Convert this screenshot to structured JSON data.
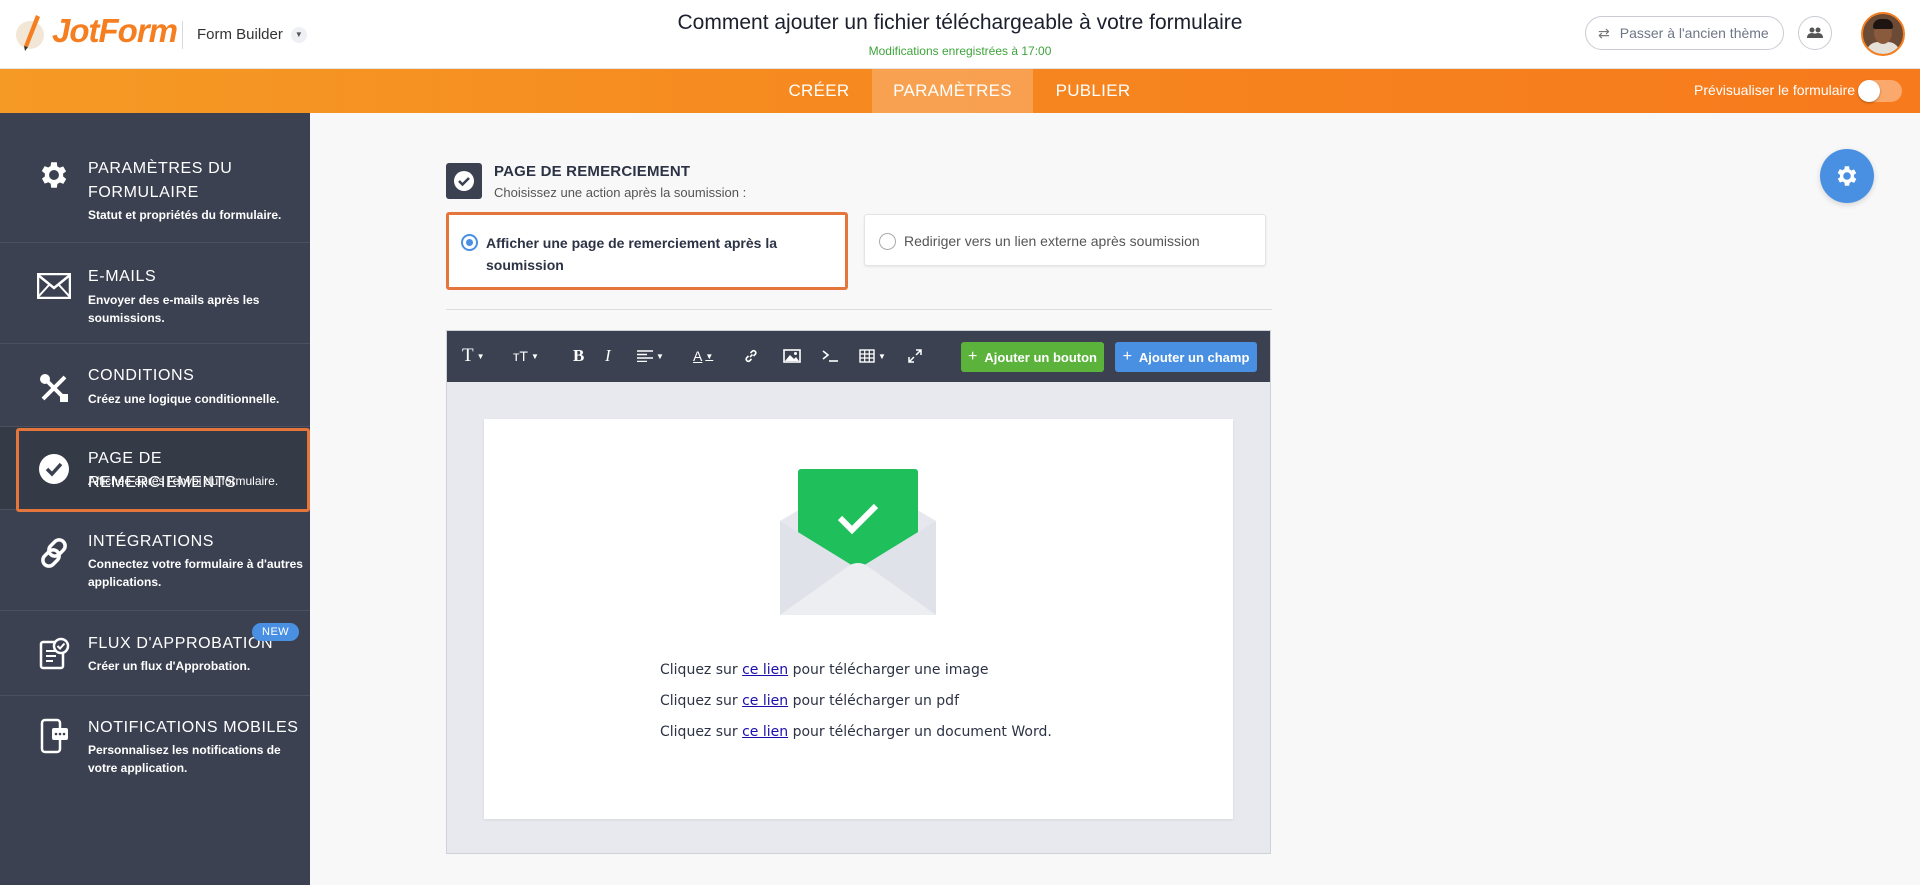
{
  "header": {
    "brand": "JotForm",
    "builder_label": "Form Builder",
    "form_title": "Comment ajouter un fichier téléchargeable à votre formulaire",
    "save_status": "Modifications enregistrées à 17:00",
    "old_theme_label": "Passer à l'ancien thème"
  },
  "nav": {
    "tabs": [
      {
        "label": "CRÉER",
        "active": false
      },
      {
        "label": "PARAMÈTRES",
        "active": true
      },
      {
        "label": "PUBLIER",
        "active": false
      }
    ],
    "preview_label": "Prévisualiser le formulaire",
    "preview_on": false
  },
  "sidebar": {
    "items": [
      {
        "icon": "gear-icon",
        "title_lines": [
          "PARAMÈTRES DU",
          "FORMULAIRE"
        ],
        "desc_lines": [
          "Statut et propriétés du formulaire."
        ]
      },
      {
        "icon": "envelope-icon",
        "title_lines": [
          "E-MAILS"
        ],
        "desc_lines": [
          "Envoyer des e-mails après les",
          "soumissions."
        ]
      },
      {
        "icon": "conditions-icon",
        "title_lines": [
          "CONDITIONS"
        ],
        "desc_lines": [
          "Créez une logique conditionnelle."
        ]
      },
      {
        "icon": "check-circle-icon",
        "title_lines": [
          "PAGE DE REMERCIEMENTS"
        ],
        "desc_lines": [
          "Affichée après l'envoi du formulaire."
        ],
        "selected": true
      },
      {
        "icon": "link-icon",
        "title_lines": [
          "INTÉGRATIONS"
        ],
        "desc_lines": [
          "Connectez votre formulaire à d'autres",
          "applications."
        ]
      },
      {
        "icon": "approval-icon",
        "title_lines": [
          "FLUX D'APPROBATION"
        ],
        "desc_lines": [
          "Créer un flux d'Approbation."
        ],
        "badge": "NEW"
      },
      {
        "icon": "mobile-notification-icon",
        "title_lines": [
          "NOTIFICATIONS MOBILES"
        ],
        "desc_lines": [
          "Personnalisez les notifications de",
          "votre application."
        ]
      }
    ]
  },
  "thankyou": {
    "section_title": "PAGE DE REMERCIEMENT",
    "section_subtitle": "Choisissez une action après la soumission :",
    "option_show_page": "Afficher une page de remerciement après la soumission",
    "option_redirect": "Rediriger vers un lien externe après soumission",
    "selected_option": "show_page"
  },
  "editor": {
    "add_button_label": "Ajouter un bouton",
    "add_field_label": "Ajouter un champ",
    "lines": [
      {
        "before": "Cliquez sur ",
        "link": "ce lien",
        "after": " pour télécharger une image"
      },
      {
        "before": "Cliquez sur ",
        "link": "ce lien",
        "after": " pour télécharger un pdf"
      },
      {
        "before": "Cliquez sur ",
        "link": "ce lien",
        "after": " pour télécharger un document Word."
      }
    ]
  },
  "colors": {
    "brand_orange": "#f57e20",
    "sidebar_bg": "#3b4150",
    "accent_blue": "#4a90e2",
    "green": "#5bb33c",
    "highlight_border": "#e5763b"
  }
}
